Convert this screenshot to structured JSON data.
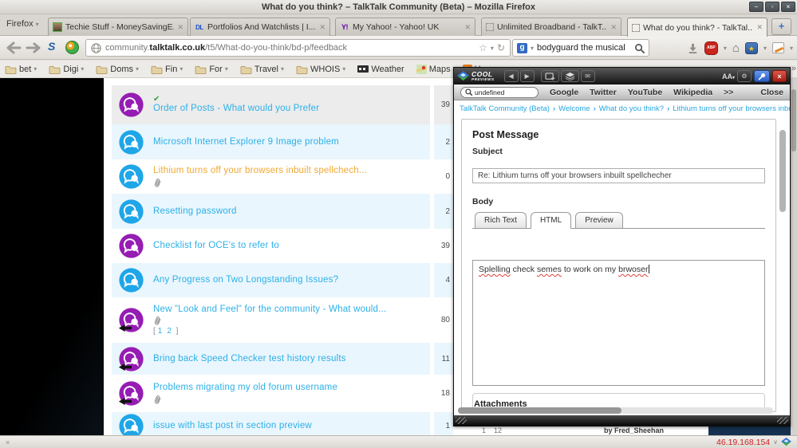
{
  "window": {
    "title": "What do you think? – TalkTalk Community (Beta) – Mozilla Firefox",
    "menu_label": "Firefox"
  },
  "tabs": {
    "items": [
      {
        "label": "Techie Stuff - MoneySavingE...",
        "favicon": "avatar",
        "active": false
      },
      {
        "label": "Portfolios And Watchlists | I...",
        "favicon": "dl",
        "active": false
      },
      {
        "label": "My Yahoo! - Yahoo! UK",
        "favicon": "yahoo",
        "active": false
      },
      {
        "label": "Unlimited Broadband - TalkT...",
        "favicon": "placeholder",
        "active": false
      },
      {
        "label": "What do you think? - TalkTal...",
        "favicon": "placeholder",
        "active": true
      }
    ]
  },
  "navbar": {
    "url_prefix": "community.",
    "url_domain": "talktalk.co.uk",
    "url_path": "/t5/What-do-you-think/bd-p/feedback",
    "search_value": "bodyguard the musical",
    "adblock_label": "ABP"
  },
  "bookmarks": {
    "items": [
      {
        "label": "bet",
        "icon": "folder",
        "caret": true
      },
      {
        "label": "Digi",
        "icon": "folder",
        "caret": true
      },
      {
        "label": "Doms",
        "icon": "folder",
        "caret": true
      },
      {
        "label": "Fin",
        "icon": "folder",
        "caret": true
      },
      {
        "label": "For",
        "icon": "folder",
        "caret": true
      },
      {
        "label": "Travel",
        "icon": "folder",
        "caret": true
      },
      {
        "label": "WHOIS",
        "icon": "folder",
        "caret": true
      },
      {
        "label": "Weather",
        "icon": "weather",
        "caret": false
      },
      {
        "label": "Maps",
        "icon": "maps",
        "caret": false
      },
      {
        "label": "Hum",
        "icon": "hum",
        "caret": false
      }
    ]
  },
  "forum": {
    "rows": [
      {
        "title": "Order of Posts - What would you Prefer",
        "count": "39",
        "icon": "purple",
        "solved": true,
        "attachment": false,
        "highlight": "blue",
        "pages": []
      },
      {
        "title": "Microsoft Internet Explorer 9 Image problem",
        "count": "2",
        "icon": "blue",
        "solved": false,
        "attachment": false,
        "highlight": "blue",
        "pages": []
      },
      {
        "title": "Lithium turns off your browsers inbuilt spellchech...",
        "count": "0",
        "icon": "blue",
        "solved": false,
        "attachment": true,
        "highlight": "orange",
        "pages": []
      },
      {
        "title": "Resetting password",
        "count": "2",
        "icon": "blue",
        "solved": false,
        "attachment": false,
        "highlight": "blue",
        "pages": []
      },
      {
        "title": "Checklist for OCE's to refer to",
        "count": "39",
        "icon": "purple",
        "solved": false,
        "attachment": false,
        "highlight": "blue",
        "pages": []
      },
      {
        "title": "Any Progress on Two Longstanding Issues?",
        "count": "4",
        "icon": "blue",
        "solved": false,
        "attachment": false,
        "highlight": "blue",
        "pages": []
      },
      {
        "title": "New \"Look and Feel\" for the community - What would...",
        "count": "80",
        "icon": "purple-moved",
        "solved": false,
        "attachment": true,
        "highlight": "blue",
        "pages": [
          "1",
          "2"
        ]
      },
      {
        "title": "Bring back Speed Checker test history results",
        "count": "11",
        "icon": "purple-moved",
        "solved": false,
        "attachment": false,
        "highlight": "blue",
        "pages": []
      },
      {
        "title": "Problems migrating my old forum username",
        "count": "18",
        "icon": "purple-moved",
        "solved": false,
        "attachment": true,
        "highlight": "blue",
        "pages": []
      },
      {
        "title": "issue with last post in section preview",
        "count": "1",
        "icon": "blue",
        "solved": false,
        "attachment": false,
        "highlight": "blue",
        "pages": []
      }
    ],
    "behind_panel_byline": "by Fred_Sheehan"
  },
  "panel": {
    "brand_top": "COOL",
    "brand_bottom": "PREVIEWS",
    "text_size_label": "AA",
    "search_value": "undefined",
    "quicklinks": [
      "Google",
      "Twitter",
      "YouTube",
      "Wikipedia",
      ">>"
    ],
    "close_label": "Close",
    "breadcrumb": [
      "TalkTalk Community (Beta)",
      "Welcome",
      "What do you think?",
      "Lithium turns off your browsers inbuilt spellchec"
    ],
    "form": {
      "title": "Post Message",
      "subject_label": "Subject",
      "subject_value": "Re: Lithium turns off your browsers inbuilt spellchecher",
      "body_label": "Body",
      "tabs": [
        {
          "label": "Rich Text",
          "active": false
        },
        {
          "label": "HTML",
          "active": true
        },
        {
          "label": "Preview",
          "active": false
        }
      ],
      "body_segments": [
        {
          "text": "Splelling",
          "misspelled": true
        },
        {
          "text": " check ",
          "misspelled": false
        },
        {
          "text": "semes",
          "misspelled": true
        },
        {
          "text": " to work on my ",
          "misspelled": false
        },
        {
          "text": "brwoser",
          "misspelled": true
        }
      ],
      "attachments_label": "Attachments"
    }
  },
  "statusbar": {
    "ip": "46.19.168.154"
  },
  "colors": {
    "talktalk_blue": "#2bb0e8",
    "highlight_orange": "#f0a832",
    "icon_purple": "#951db3",
    "icon_blue": "#1ea6e8",
    "abp_red": "#c8251d",
    "pin_blue": "#2a5fc0",
    "close_red": "#a61f14",
    "ip_red": "#cc2222"
  }
}
